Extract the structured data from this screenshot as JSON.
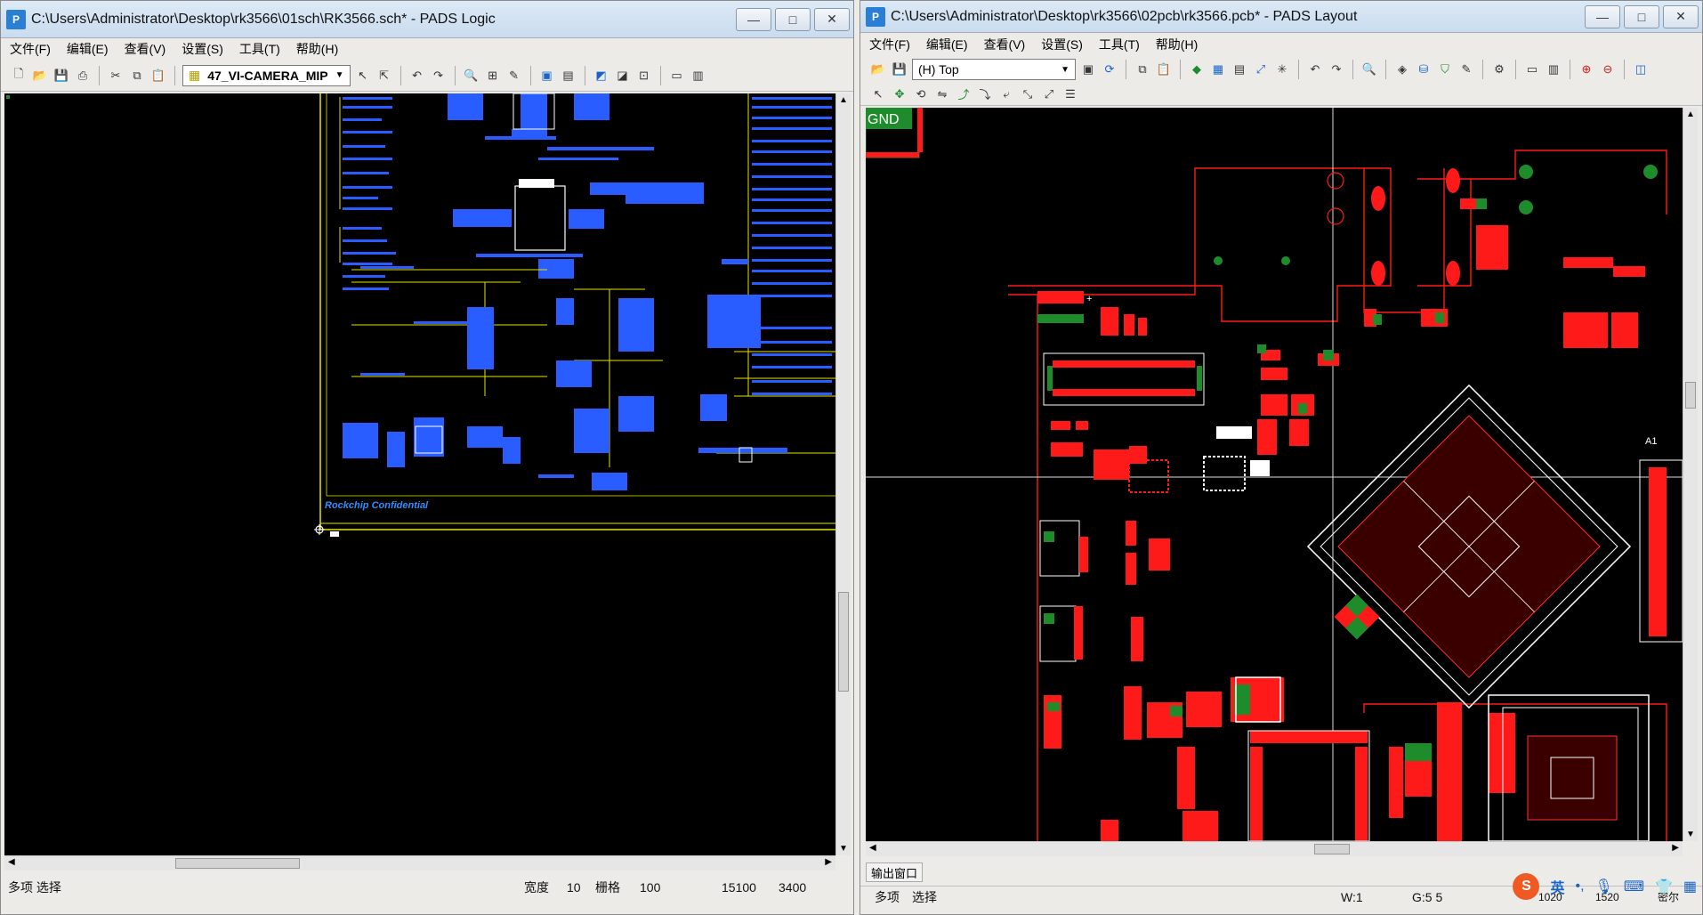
{
  "left": {
    "title": "C:\\Users\\Administrator\\Desktop\\rk3566\\01sch\\RK3566.sch* - PADS Logic",
    "app_icon": "PADS Logic icon",
    "menu": [
      "文件(F)",
      "编辑(E)",
      "查看(V)",
      "设置(S)",
      "工具(T)",
      "帮助(H)"
    ],
    "sheet_selector": "47_VI-CAMERA_MIP",
    "schematic_label": "Rockchip Confidential",
    "status": {
      "mode": "多项 选择",
      "width_label": "宽度",
      "width_value": "10",
      "grid_label": "栅格",
      "grid_value": "100",
      "x": "15100",
      "y": "3400"
    }
  },
  "right": {
    "title": "C:\\Users\\Administrator\\Desktop\\rk3566\\02pcb\\rk3566.pcb* - PADS Layout",
    "app_icon": "PADS Layout icon",
    "menu": [
      "文件(F)",
      "编辑(E)",
      "查看(V)",
      "设置(S)",
      "工具(T)",
      "帮助(H)"
    ],
    "layer_selector": "(H) Top",
    "board_labels": {
      "gnd": "GND",
      "a1": "A1"
    },
    "output_tab": "输出窗口",
    "status": {
      "mode": "多项",
      "mode2": "选择",
      "w": "W:1",
      "g": "G:5 5",
      "x": "1020",
      "y": "1520",
      "unit": "密尔"
    },
    "ime": {
      "logo": "S",
      "lang": "英"
    }
  },
  "colors": {
    "canvas": "#000000",
    "schematic_blue": "#2a5dff",
    "schematic_yellow": "#e4e400",
    "pcb_red": "#ff1a1a",
    "pcb_green": "#1e8c2a",
    "pcb_white": "#ffffff"
  }
}
